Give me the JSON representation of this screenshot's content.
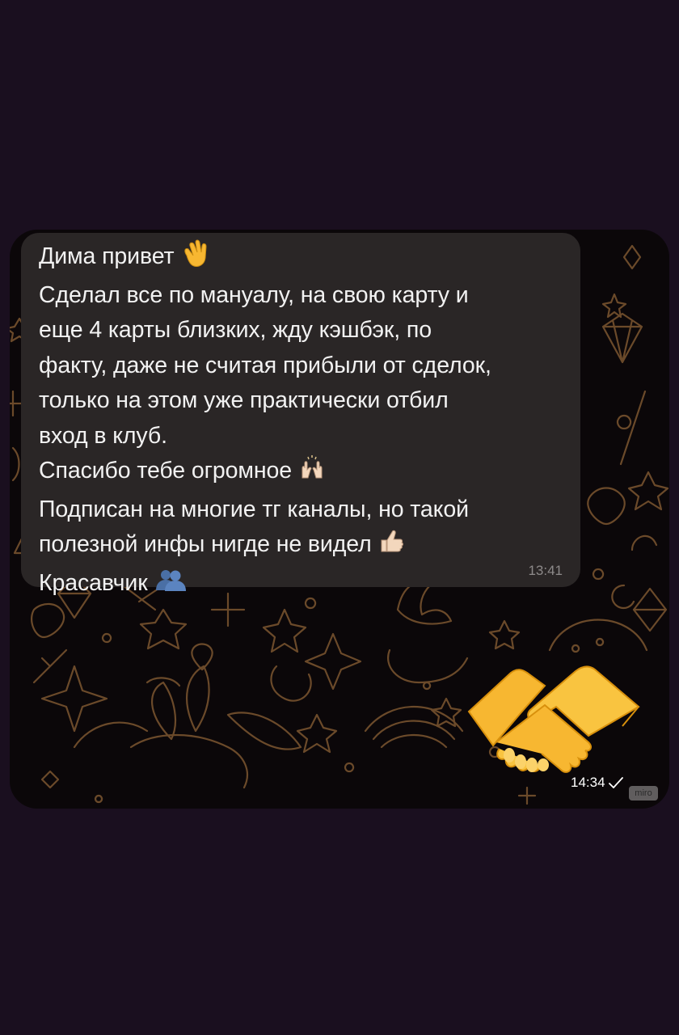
{
  "chat": {
    "incoming": {
      "lines": [
        "Дима привет",
        "Сделал все по мануалу, на свою карту и",
        "еще 4 карты близких, жду кэшбэк, по",
        "факту, даже не считая прибыли от сделок,",
        "только на этом уже практически отбил",
        "вход в клуб.",
        "Спасибо тебе огромное",
        "Подписан на многие тг каналы, но такой",
        "полезной инфы нигде не видел",
        "Красавчик"
      ],
      "time": "13:41",
      "emojis": [
        "waving-hand",
        "raising-hands",
        "thumbs-up",
        "busts-in-silhouette"
      ]
    },
    "outgoing_sticker": {
      "sticker": "handshake",
      "time": "14:34",
      "status": "sent-check"
    }
  },
  "watermark": "miro",
  "colors": {
    "background": "#1a0f1f",
    "bubble": "#2a2626",
    "doodle": "#6b4a2a",
    "sticker": "#f7b731"
  }
}
